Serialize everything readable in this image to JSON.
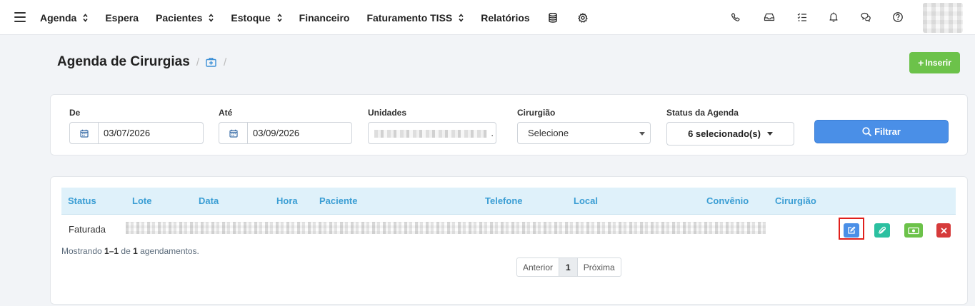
{
  "nav": {
    "items": [
      {
        "label": "Agenda",
        "has_caret": true
      },
      {
        "label": "Espera",
        "has_caret": false
      },
      {
        "label": "Pacientes",
        "has_caret": true
      },
      {
        "label": "Estoque",
        "has_caret": true
      },
      {
        "label": "Financeiro",
        "has_caret": false
      },
      {
        "label": "Faturamento TISS",
        "has_caret": true
      },
      {
        "label": "Relatórios",
        "has_caret": false
      }
    ],
    "extra_icons": [
      "database-icon",
      "gear-icon"
    ],
    "right_icons": [
      "phone-icon",
      "inbox-icon",
      "checklist-icon",
      "bell-icon",
      "chat-icon",
      "help-icon"
    ]
  },
  "header": {
    "title": "Agenda de Cirurgias",
    "breadcrumb_icon": "medical-briefcase-icon",
    "insert_label": "Inserir"
  },
  "filters": {
    "de_label": "De",
    "de_value": "03/07/2026",
    "ate_label": "Até",
    "ate_value": "03/09/2026",
    "unidades_label": "Unidades",
    "unidades_trailing": ".",
    "cirurgiao_label": "Cirurgião",
    "cirurgiao_value": "Selecione",
    "status_label": "Status da Agenda",
    "status_value": "6 selecionado(s)",
    "filter_button": "Filtrar"
  },
  "table": {
    "columns": [
      "Status",
      "Lote",
      "Data",
      "Hora",
      "Paciente",
      "Telefone",
      "Local",
      "Convênio",
      "Cirurgião"
    ],
    "rows": [
      {
        "status": "Faturada"
      }
    ],
    "actions": [
      "edit-icon",
      "attach-icon",
      "money-icon",
      "close-icon"
    ],
    "showing_prefix": "Mostrando ",
    "showing_range": "1–1",
    "showing_mid": " de ",
    "showing_total": "1",
    "showing_suffix": " agendamentos.",
    "pager": {
      "prev": "Anterior",
      "current": "1",
      "next": "Próxima"
    }
  },
  "colors": {
    "accent_blue": "#4a8fe7",
    "insert_green": "#6cc24a",
    "header_text_blue": "#3b9ed4",
    "edit_btn": "#4a8fe7",
    "attach_btn": "#2bc0a0",
    "money_btn": "#6cc24a",
    "delete_btn": "#d63b3b"
  }
}
